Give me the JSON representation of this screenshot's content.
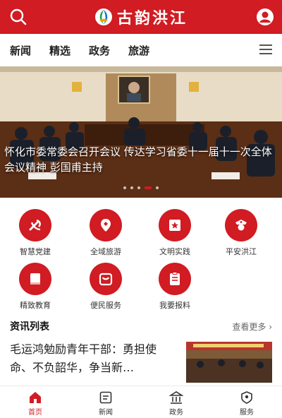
{
  "header": {
    "app_title": "古韵洪江",
    "search_icon": "search-icon",
    "user_icon": "user-icon"
  },
  "nav": {
    "tabs": [
      "新闻",
      "精选",
      "政务",
      "旅游"
    ],
    "menu_icon": "menu-icon"
  },
  "banner": {
    "caption": "怀化市委常委会召开会议 传达学习省委十一届十一次全体会议精神 彭国甫主持",
    "slide_count": 5,
    "active_slide": 4
  },
  "services": [
    {
      "label": "智慧党建",
      "icon": "party-emblem-icon"
    },
    {
      "label": "全域旅游",
      "icon": "travel-icon"
    },
    {
      "label": "文明实践",
      "icon": "flag-icon"
    },
    {
      "label": "平安洪江",
      "icon": "police-icon"
    },
    {
      "label": "精致教育",
      "icon": "book-icon"
    },
    {
      "label": "便民服务",
      "icon": "bag-icon"
    },
    {
      "label": "我要报料",
      "icon": "report-icon"
    }
  ],
  "news_list": {
    "title": "资讯列表",
    "more": "查看更多 ›",
    "items": [
      {
        "title": "毛运鸿勉励青年干部：勇担使命、不负韶华，争当新…"
      }
    ]
  },
  "tabbar": {
    "items": [
      {
        "label": "首页",
        "icon": "home-icon",
        "active": true
      },
      {
        "label": "新闻",
        "icon": "news-icon",
        "active": false
      },
      {
        "label": "政务",
        "icon": "government-icon",
        "active": false
      },
      {
        "label": "服务",
        "icon": "service-icon",
        "active": false
      }
    ]
  },
  "colors": {
    "brand_red": "#d01c22"
  }
}
